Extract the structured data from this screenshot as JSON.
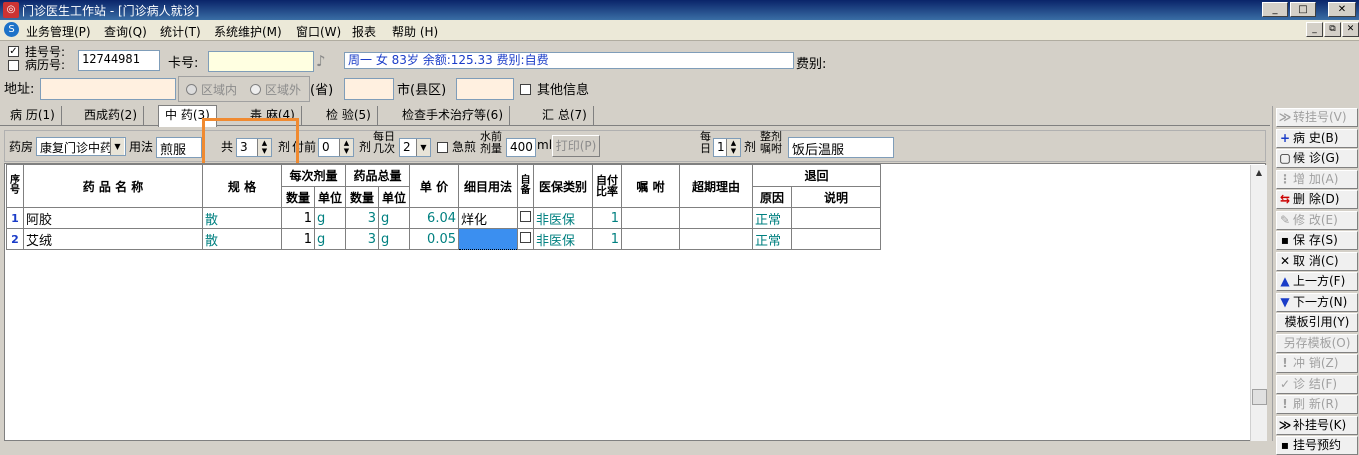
{
  "window": {
    "title": "门诊医生工作站 - [门诊病人就诊]",
    "controls": [
      "_",
      "□",
      "✕"
    ],
    "mdi_controls": [
      "_",
      "⧉",
      "✕"
    ]
  },
  "menu": [
    "业务管理(P)",
    "查询(Q)",
    "统计(T)",
    "系统维护(M)",
    "窗口(W)",
    "报表",
    "帮助 (H)"
  ],
  "patient": {
    "reg_no_label": "挂号号:",
    "record_no_label": "病历号:",
    "record_no": "12744981",
    "card_label": "卡号:",
    "card_value": "",
    "summary": "周一 女 83岁 余额:125.33 费别:自费",
    "fee_type_label": "费别:",
    "address_label": "地址:",
    "area_in": "区域内",
    "area_out": "区域外",
    "province_label": "(省)",
    "city_label": "市(县区)",
    "other_info_label": "其他信息"
  },
  "tabs": [
    "病 历(1)",
    "西成药(2)",
    "中 药(3)",
    "毒 麻(4)",
    "检 验(5)",
    "检查手术治疗等(6)",
    "汇 总(7)"
  ],
  "active_tab": 2,
  "toolbar": {
    "pharmacy_label": "药房",
    "pharmacy": "康复门诊中药",
    "usage_label": "用法",
    "usage": "煎服",
    "total_label": "共",
    "total": "3",
    "dose_unit": "剂",
    "before_label": "付前",
    "before": "0",
    "dose_label2": "剂",
    "daily_label1": "每日",
    "daily_label2": "几次",
    "daily": "2",
    "urgent_label": "急煎",
    "water_label1": "水前",
    "water_label2": "剂量",
    "water": "400",
    "water_unit": "ml",
    "print_label": "打印(P)",
    "per_day_label1": "每",
    "per_day_label2": "日",
    "per_day": "1",
    "dose_label3": "剂",
    "whole_label1": "整剂",
    "whole_label2": "嘱咐",
    "whole": "饭后温服"
  },
  "grid": {
    "headers": {
      "seq": "序号",
      "name": "药 品 名 称",
      "spec": "规 格",
      "per_dose": "每次剂量",
      "total_qty": "药品总量",
      "qty": "数量",
      "unit": "单位",
      "price": "单 价",
      "method": "细目用法",
      "self": "自备",
      "insurance": "医保类别",
      "self_pay": "自付比率",
      "note": "嘱 咐",
      "overlimit": "超期理由",
      "return": "退回",
      "reason": "原因",
      "desc": "说明"
    },
    "rows": [
      {
        "seq": "1",
        "name": "阿胶",
        "spec": "散",
        "dose_qty": "1",
        "dose_unit": "g",
        "total_qty": "3",
        "total_unit": "g",
        "price": "6.04",
        "method": "烊化",
        "insurance": "非医保",
        "self_pay": "1",
        "reason": "正常"
      },
      {
        "seq": "2",
        "name": "艾绒",
        "spec": "散",
        "dose_qty": "1",
        "dose_unit": "g",
        "total_qty": "3",
        "total_unit": "g",
        "price": "0.05",
        "method": "",
        "insurance": "非医保",
        "self_pay": "1",
        "reason": "正常"
      }
    ]
  },
  "side_buttons": [
    {
      "icon": "≫",
      "label": "转挂号(V)",
      "enabled": false
    },
    {
      "icon": "+",
      "label": "病 史(B)",
      "enabled": true
    },
    {
      "icon": "▢",
      "label": "候 诊(G)",
      "enabled": true
    },
    {
      "icon": "⋮",
      "label": "增 加(A)",
      "enabled": false
    },
    {
      "icon": "⇆",
      "label": "删 除(D)",
      "enabled": true
    },
    {
      "icon": "✎",
      "label": "修 改(E)",
      "enabled": false
    },
    {
      "icon": "▪",
      "label": "保 存(S)",
      "enabled": true
    },
    {
      "icon": "✕",
      "label": "取 消(C)",
      "enabled": true
    },
    {
      "icon": "▲",
      "label": "上一方(F)",
      "enabled": true
    },
    {
      "icon": "▼",
      "label": "下一方(N)",
      "enabled": true
    },
    {
      "icon": "",
      "label": "模板引用(Y)",
      "enabled": true
    },
    {
      "icon": "",
      "label": "另存模板(O)",
      "enabled": false
    },
    {
      "icon": "!",
      "label": "冲 销(Z)",
      "enabled": false
    },
    {
      "icon": "✓",
      "label": "诊 结(F)",
      "enabled": false
    },
    {
      "icon": "!",
      "label": "刷 新(R)",
      "enabled": false
    },
    {
      "icon": "≫",
      "label": "补挂号(K)",
      "enabled": true
    },
    {
      "icon": "▪",
      "label": "挂号预约",
      "enabled": true
    }
  ],
  "colors": {
    "accent_highlight": "#f08a30",
    "teal_text": "#008080",
    "selected_cell": "#3b8ff0"
  }
}
